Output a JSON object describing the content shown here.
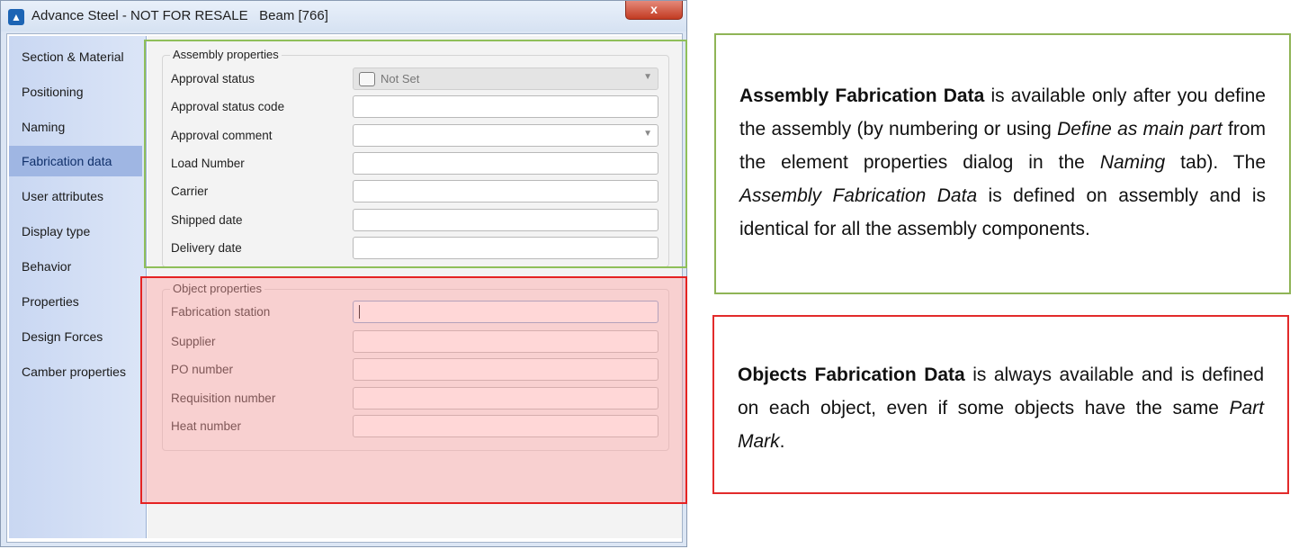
{
  "window": {
    "title": "Advance Steel - NOT FOR RESALE   Beam [766]",
    "close_label": "x"
  },
  "sidebar": {
    "items": [
      {
        "label": "Section & Material"
      },
      {
        "label": "Positioning"
      },
      {
        "label": "Naming"
      },
      {
        "label": "Fabrication data",
        "active": true
      },
      {
        "label": "User attributes"
      },
      {
        "label": "Display type"
      },
      {
        "label": "Behavior"
      },
      {
        "label": "Properties"
      },
      {
        "label": "Design Forces"
      },
      {
        "label": "Camber properties"
      }
    ]
  },
  "assembly": {
    "title": "Assembly properties",
    "rows": [
      {
        "label": "Approval status",
        "value": "Not Set"
      },
      {
        "label": "Approval status code",
        "value": ""
      },
      {
        "label": "Approval comment",
        "value": ""
      },
      {
        "label": "Load Number",
        "value": ""
      },
      {
        "label": "Carrier",
        "value": ""
      },
      {
        "label": "Shipped date",
        "value": ""
      },
      {
        "label": "Delivery date",
        "value": ""
      }
    ]
  },
  "object": {
    "title": "Object properties",
    "rows": [
      {
        "label": "Fabrication station",
        "value": ""
      },
      {
        "label": "Supplier",
        "value": ""
      },
      {
        "label": "PO number",
        "value": ""
      },
      {
        "label": "Requisition number",
        "value": ""
      },
      {
        "label": "Heat number",
        "value": ""
      }
    ]
  },
  "callouts": {
    "assembly": {
      "bold": "Assembly Fabrication Data",
      "t1": " is available only after you define the assembly (by numbering or using ",
      "i1": "Define as main part",
      "t2": " from the element properties dialog in the ",
      "i2": "Naming",
      "t3": " tab). The ",
      "i3": "Assembly Fabrication Data",
      "t4": " is defined on assembly and is identical for all the assembly components."
    },
    "objects": {
      "bold": "Objects Fabrication Data",
      "t1": " is always available and is defined on each object, even if some objects have the same ",
      "i1": "Part Mark",
      "t2": "."
    }
  },
  "colors": {
    "assembly_highlight": "#8fbf5a",
    "objects_highlight": "#e52222",
    "sidebar_active": "#9fb6e3"
  }
}
